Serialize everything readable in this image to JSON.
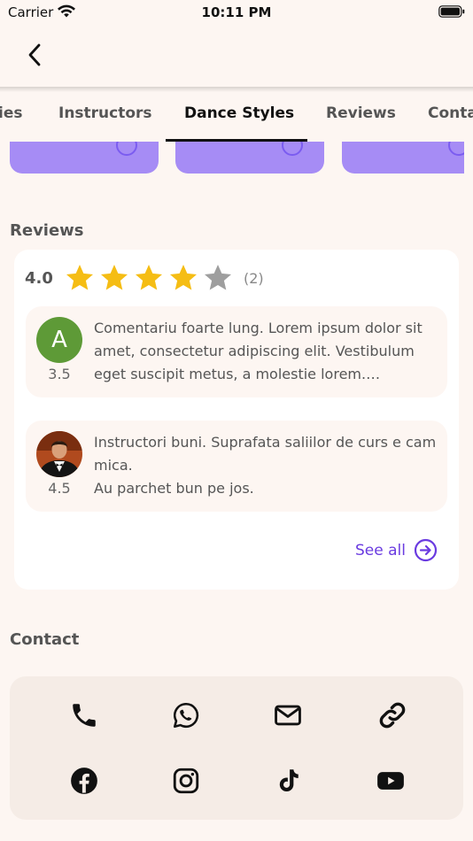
{
  "status_bar": {
    "carrier": "Carrier",
    "time": "10:11 PM"
  },
  "tabs": [
    {
      "label": "ies"
    },
    {
      "label": "Instructors"
    },
    {
      "label": "Dance Styles",
      "active": true
    },
    {
      "label": "Reviews"
    },
    {
      "label": "Conta"
    }
  ],
  "reviews_section": {
    "title": "Reviews",
    "average_rating": "4.0",
    "stars_filled": 4,
    "stars_total": 5,
    "review_count": "(2)",
    "items": [
      {
        "avatar_letter": "A",
        "avatar_color": "#5e9a37",
        "score": "3.5",
        "text": "Comentariu foarte lung. Lorem ipsum dolor sit amet, consectetur adipiscing elit. Vestibulum eget suscipit metus, a molestie lorem. Pellentesque"
      },
      {
        "avatar_icon": "person-photo",
        "score": "4.5",
        "text_line1": "Instructori buni. Suprafata saliilor de curs e cam mica.",
        "text_line2": "Au parchet bun pe jos."
      }
    ],
    "see_all_label": "See all"
  },
  "contact_section": {
    "title": "Contact",
    "icons": [
      "phone-icon",
      "whatsapp-icon",
      "email-icon",
      "link-icon",
      "facebook-icon",
      "instagram-icon",
      "tiktok-icon",
      "youtube-icon"
    ]
  },
  "colors": {
    "background": "#fdf6f2",
    "accent": "#6a3be0",
    "card_purple": "#a68cf5",
    "star_filled": "#f5bd14",
    "star_empty": "#9e9e9e",
    "contact_card": "#f5ece6"
  }
}
